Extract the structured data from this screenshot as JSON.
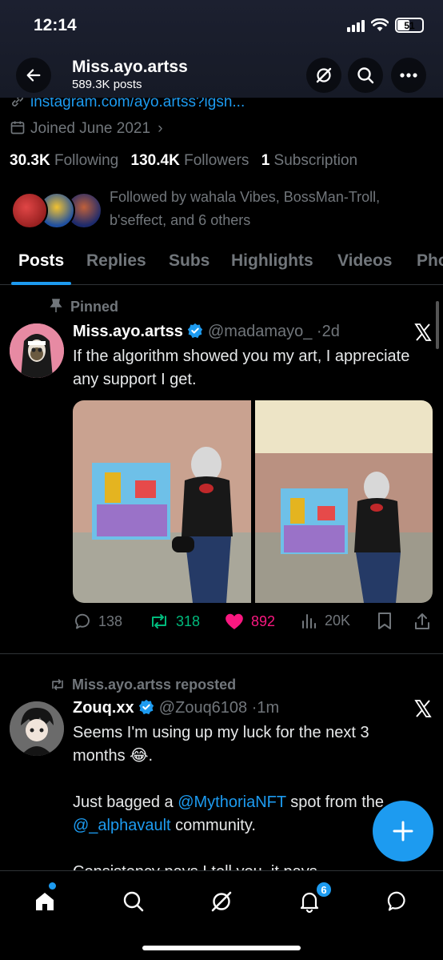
{
  "status_bar": {
    "time": "12:14",
    "battery": "51",
    "battery_level": 0.51
  },
  "header": {
    "title": "Miss.ayo.artss",
    "subtitle": "589.3K posts"
  },
  "profile": {
    "link": "instagram.com/ayo.artss?igsh...",
    "joined": "Joined June 2021",
    "following_count": "30.3K",
    "following_label": "Following",
    "followers_count": "130.4K",
    "followers_label": "Followers",
    "subs_count": "1",
    "subs_label": "Subscription",
    "followed_by": "Followed by wahala Vibes, BossMan-Troll, b'seffect, and 6 others"
  },
  "tabs": [
    {
      "label": "Posts",
      "active": true
    },
    {
      "label": "Replies"
    },
    {
      "label": "Subs"
    },
    {
      "label": "Highlights"
    },
    {
      "label": "Videos"
    },
    {
      "label": "Pho"
    }
  ],
  "posts": [
    {
      "context": "Pinned",
      "name": "Miss.ayo.artss",
      "handle": "@madamayo_",
      "sep": "·",
      "time": "2d",
      "text": "If the algorithm showed you my art, I appreciate any support I get.",
      "stats": {
        "replies": "138",
        "reposts": "318",
        "likes": "892",
        "views": "20K"
      }
    },
    {
      "context": "Miss.ayo.artss reposted",
      "name": "Zouq.xx",
      "handle": "@Zouq6108",
      "sep": "·",
      "time": "1m",
      "line1": "Seems I'm using up my luck for the next 3 months 😂.",
      "line2_a": "Just bagged a ",
      "mention1": "@MythoriaNFT",
      "line2_b": " spot from the",
      "mention2": "@_alphavault",
      "line2_c": " community.",
      "line3": "Consistency pays I tell you, it pays."
    }
  ],
  "nav": {
    "notification_badge": "6"
  },
  "colors": {
    "accent": "#1d9bf0",
    "like": "#f91880",
    "repost": "#00ba7c",
    "muted": "#71767b"
  }
}
